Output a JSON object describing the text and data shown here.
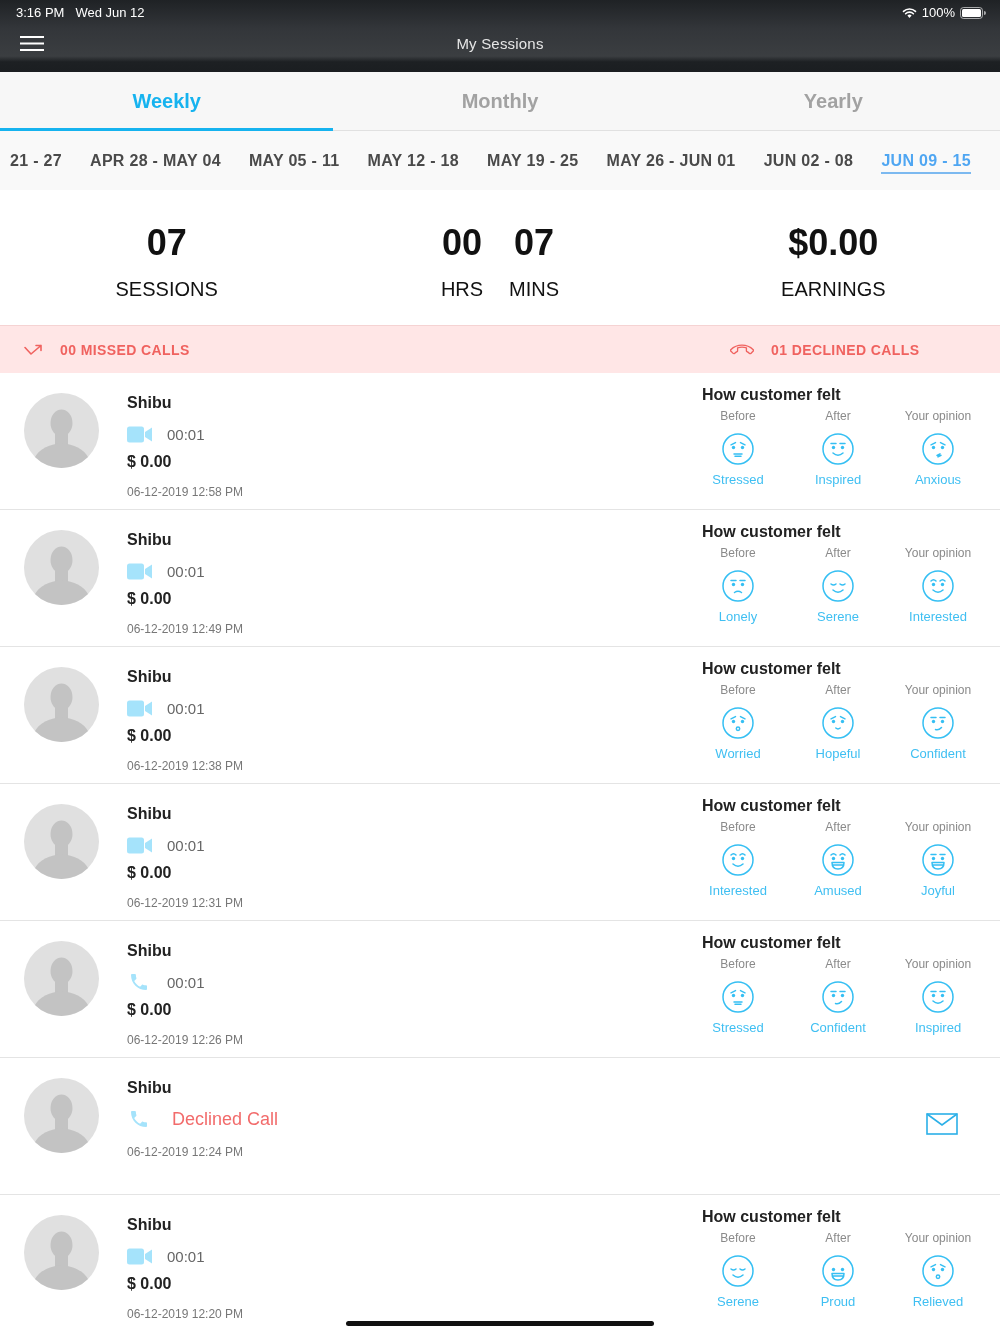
{
  "status_bar": {
    "time": "3:16 PM",
    "date": "Wed Jun 12",
    "battery": "100%"
  },
  "nav_bar": {
    "title": "My Sessions"
  },
  "tabs": [
    {
      "label": "Weekly",
      "selected": true
    },
    {
      "label": "Monthly",
      "selected": false
    },
    {
      "label": "Yearly",
      "selected": false
    }
  ],
  "weeks": [
    {
      "label": "21 - 27",
      "selected": false
    },
    {
      "label": "APR 28 - MAY 04",
      "selected": false
    },
    {
      "label": "MAY 05 - 11",
      "selected": false
    },
    {
      "label": "MAY 12 - 18",
      "selected": false
    },
    {
      "label": "MAY 19 - 25",
      "selected": false
    },
    {
      "label": "MAY 26 - JUN 01",
      "selected": false
    },
    {
      "label": "JUN 02 - 08",
      "selected": false
    },
    {
      "label": "JUN 09 - 15",
      "selected": true
    }
  ],
  "summary": [
    {
      "items": [
        {
          "value": "07",
          "label": "SESSIONS"
        }
      ]
    },
    {
      "items": [
        {
          "value": "00",
          "label": "HRS"
        },
        {
          "value": "07",
          "label": "MINS"
        }
      ]
    },
    {
      "items": [
        {
          "value": "$0.00",
          "label": "EARNINGS"
        }
      ]
    }
  ],
  "call_stats": {
    "missed": "00 MISSED CALLS",
    "declined": "01 DECLINED CALLS"
  },
  "sessions": [
    {
      "kind": "completed",
      "name": "Shibu",
      "call": {
        "kind": "video",
        "text": "00:01"
      },
      "amount": "$ 0.00",
      "datetime": "06-12-2019 12:58 PM",
      "feedback": {
        "title": "How customer felt",
        "moods": [
          {
            "heading": "Before",
            "mood": "Stressed",
            "kind": "stressed"
          },
          {
            "heading": "After",
            "mood": "Inspired",
            "kind": "inspired"
          },
          {
            "heading": "Your opinion",
            "mood": "Anxious",
            "kind": "anxious"
          }
        ]
      }
    },
    {
      "kind": "completed",
      "name": "Shibu",
      "call": {
        "kind": "video",
        "text": "00:01"
      },
      "amount": "$ 0.00",
      "datetime": "06-12-2019 12:49 PM",
      "feedback": {
        "title": "How customer felt",
        "moods": [
          {
            "heading": "Before",
            "mood": "Lonely",
            "kind": "lonely"
          },
          {
            "heading": "After",
            "mood": "Serene",
            "kind": "serene"
          },
          {
            "heading": "Your opinion",
            "mood": "Interested",
            "kind": "interested"
          }
        ]
      }
    },
    {
      "kind": "completed",
      "name": "Shibu",
      "call": {
        "kind": "video",
        "text": "00:01"
      },
      "amount": "$ 0.00",
      "datetime": "06-12-2019 12:38 PM",
      "feedback": {
        "title": "How customer felt",
        "moods": [
          {
            "heading": "Before",
            "mood": "Worried",
            "kind": "worried"
          },
          {
            "heading": "After",
            "mood": "Hopeful",
            "kind": "hopeful"
          },
          {
            "heading": "Your opinion",
            "mood": "Confident",
            "kind": "confident"
          }
        ]
      }
    },
    {
      "kind": "completed",
      "name": "Shibu",
      "call": {
        "kind": "video",
        "text": "00:01"
      },
      "amount": "$ 0.00",
      "datetime": "06-12-2019 12:31 PM",
      "feedback": {
        "title": "How customer felt",
        "moods": [
          {
            "heading": "Before",
            "mood": "Interested",
            "kind": "interested"
          },
          {
            "heading": "After",
            "mood": "Amused",
            "kind": "amused"
          },
          {
            "heading": "Your opinion",
            "mood": "Joyful",
            "kind": "joyful"
          }
        ]
      }
    },
    {
      "kind": "completed",
      "name": "Shibu",
      "call": {
        "kind": "audio",
        "text": "00:01"
      },
      "amount": "$ 0.00",
      "datetime": "06-12-2019 12:26 PM",
      "feedback": {
        "title": "How customer felt",
        "moods": [
          {
            "heading": "Before",
            "mood": "Stressed",
            "kind": "stressed"
          },
          {
            "heading": "After",
            "mood": "Confident",
            "kind": "confident"
          },
          {
            "heading": "Your opinion",
            "mood": "Inspired",
            "kind": "inspired"
          }
        ]
      }
    },
    {
      "kind": "declined",
      "name": "Shibu",
      "call": {
        "kind": "audio",
        "text": "Declined Call"
      },
      "datetime": "06-12-2019 12:24 PM"
    },
    {
      "kind": "completed",
      "name": "Shibu",
      "call": {
        "kind": "video",
        "text": "00:01"
      },
      "amount": "$ 0.00",
      "datetime": "06-12-2019 12:20 PM",
      "feedback": {
        "title": "How customer felt",
        "moods": [
          {
            "heading": "Before",
            "mood": "Serene",
            "kind": "serene"
          },
          {
            "heading": "After",
            "mood": "Proud",
            "kind": "proud"
          },
          {
            "heading": "Your opinion",
            "mood": "Relieved",
            "kind": "relieved"
          }
        ]
      }
    }
  ]
}
